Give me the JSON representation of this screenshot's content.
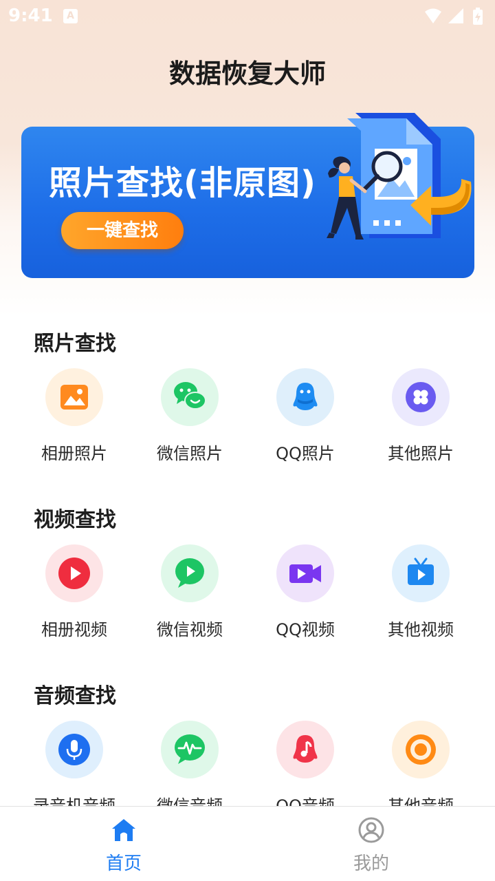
{
  "status_bar": {
    "time": "9:41",
    "notification_icon_text": "A",
    "icons": [
      "wifi-icon",
      "signal-icon",
      "battery-charging-icon"
    ]
  },
  "app": {
    "title": "数据恢复大师"
  },
  "banner": {
    "title": "照片查找(非原图)",
    "button_label": "一键查找",
    "illustration": "person-with-magnifier-and-photo-file"
  },
  "sections": [
    {
      "title": "照片查找",
      "items": [
        {
          "label": "相册照片",
          "icon": "gallery-image-icon",
          "color": "#ff8a1f",
          "bg": "#fff1df"
        },
        {
          "label": "微信照片",
          "icon": "wechat-icon",
          "color": "#1dc564",
          "bg": "#dff8e9"
        },
        {
          "label": "QQ照片",
          "icon": "qq-penguin-icon",
          "color": "#1e8cf2",
          "bg": "#dfeffb"
        },
        {
          "label": "其他照片",
          "icon": "clover-grid-icon",
          "color": "#6a5bf0",
          "bg": "#ebe9fd"
        }
      ]
    },
    {
      "title": "视频查找",
      "items": [
        {
          "label": "相册视频",
          "icon": "play-circle-icon",
          "color": "#ef2d3f",
          "bg": "#fde4e6"
        },
        {
          "label": "微信视频",
          "icon": "chat-play-icon",
          "color": "#1dc564",
          "bg": "#dff8e9"
        },
        {
          "label": "QQ视频",
          "icon": "video-camera-icon",
          "color": "#7a36f0",
          "bg": "#efe3fb"
        },
        {
          "label": "其他视频",
          "icon": "tv-play-icon",
          "color": "#1e88f0",
          "bg": "#dff0fd"
        }
      ]
    },
    {
      "title": "音频查找",
      "items": [
        {
          "label": "录音机音频",
          "icon": "microphone-icon",
          "color": "#1e6ff0",
          "bg": "#dfeffd"
        },
        {
          "label": "微信音频",
          "icon": "chat-waveform-icon",
          "color": "#1dc564",
          "bg": "#dff8e9"
        },
        {
          "label": "QQ音频",
          "icon": "qq-music-note-icon",
          "color": "#f03449",
          "bg": "#fde3e6"
        },
        {
          "label": "其他音频",
          "icon": "record-disc-icon",
          "color": "#ff8a14",
          "bg": "#fff0dc"
        }
      ]
    }
  ],
  "tab_bar": {
    "tabs": [
      {
        "label": "首页",
        "icon": "home-icon",
        "active": true,
        "color": "#1d7cf2"
      },
      {
        "label": "我的",
        "icon": "user-profile-icon",
        "active": false,
        "color": "#9a9a9a"
      }
    ]
  }
}
